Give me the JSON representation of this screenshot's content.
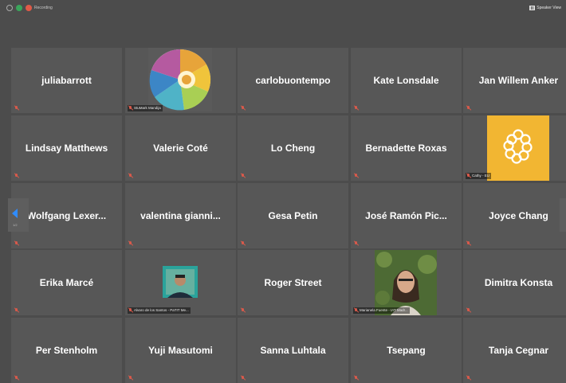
{
  "window": {
    "recording_label": "Recording",
    "view_button_label": "Speaker View",
    "status_colors": {
      "shield": "#3aa55b",
      "record": "#e05a47",
      "mute": "#d95a4b",
      "accent": "#2f8cff"
    }
  },
  "pagination": {
    "page_label": "1/2"
  },
  "participants": [
    {
      "name": "juliabarrott"
    },
    {
      "name": "",
      "tag": "StuMark Mandija",
      "video": "logo"
    },
    {
      "name": "carlobuontempo"
    },
    {
      "name": "Kate Lonsdale"
    },
    {
      "name": "Jan Willem Anker"
    },
    {
      "name": "Lindsay Matthews"
    },
    {
      "name": "Valerie Coté"
    },
    {
      "name": "Lo Cheng"
    },
    {
      "name": "Bernadette Roxas"
    },
    {
      "name": "",
      "tag": "Cathy - EU",
      "video": "rings"
    },
    {
      "name": "Wolfgang  Lexer..."
    },
    {
      "name": "valentina  gianni..."
    },
    {
      "name": "Gesa Petin"
    },
    {
      "name": "José Ramón Pic..."
    },
    {
      "name": "Joyce Chang"
    },
    {
      "name": "Erika Marcé"
    },
    {
      "name": "",
      "tag": "Alvaro de los Santos - PaTIT Me...",
      "video": "man"
    },
    {
      "name": "Roger Street"
    },
    {
      "name": "",
      "tag": "Marianela Fuente - IAT Madr...",
      "video": "woman"
    },
    {
      "name": "Dimitra Konsta"
    },
    {
      "name": "Per Stenholm"
    },
    {
      "name": "Yuji Masutomi"
    },
    {
      "name": "Sanna Luhtala"
    },
    {
      "name": "Tsepang"
    },
    {
      "name": "Tanja Cegnar"
    }
  ]
}
